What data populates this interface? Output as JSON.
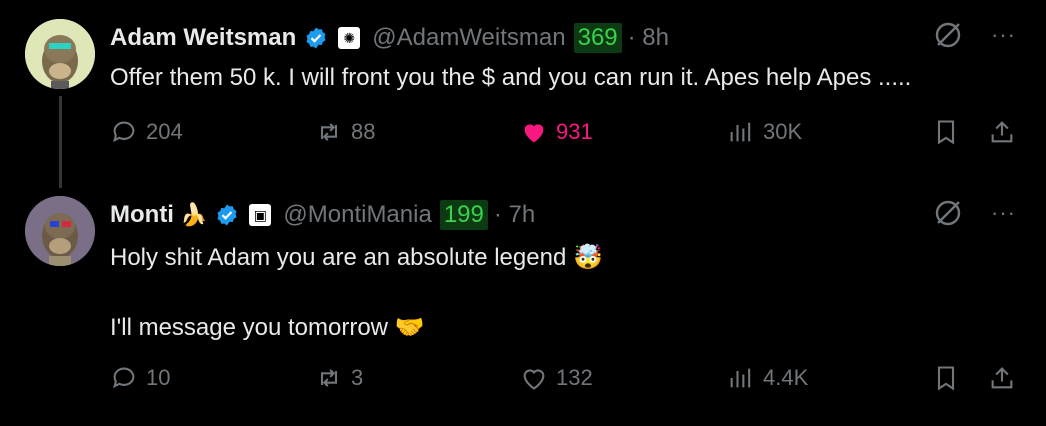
{
  "tweets": [
    {
      "name": "Adam Weitsman",
      "handle": "@AdamWeitsman",
      "score": "369",
      "time": "· 8h",
      "text": "Offer them 50 k. I will front you the $ and you can run it. Apes help Apes .....",
      "replies": "204",
      "reposts": "88",
      "likes": "931",
      "views": "30K",
      "liked": true
    },
    {
      "name": "Monti",
      "name_emoji": "🍌",
      "handle": "@MontiMania",
      "score": "199",
      "time": "· 7h",
      "text_line1": "Holy shit Adam you are an absolute legend",
      "emoji1": "🤯",
      "text_line2": "I'll message you tomorrow",
      "emoji2": "🤝",
      "replies": "10",
      "reposts": "3",
      "likes": "132",
      "views": "4.4K",
      "liked": false
    }
  ],
  "more_label": "···",
  "colors": {
    "accent_like": "#f91880",
    "verified": "#1d9bf0",
    "score_green": "#3bd14b",
    "muted": "#71767b"
  }
}
